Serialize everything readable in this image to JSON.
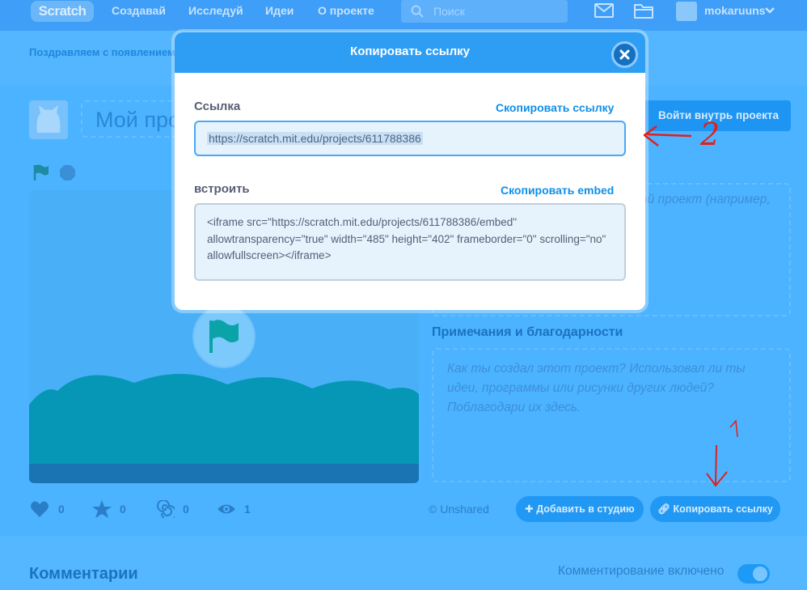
{
  "topbar": {
    "logo": "Scratch",
    "nav": [
      "Создавай",
      "Исследуй",
      "Идеи",
      "О проекте"
    ],
    "search_placeholder": "Поиск",
    "username": "mokaruuns"
  },
  "banner": {
    "text": "Поздравляем с появлением комментарии и делать ре"
  },
  "project": {
    "title": "Мой проект",
    "see_inside": "Войти внутрь проекта",
    "instructions_placeholder": "ой проект (например,",
    "notes_heading": "Примечания и благодарности",
    "notes_placeholder": "Как ты создал этот проект? Использовал ли ты идеи, программы или рисунки других людей? Поблагодари их здесь.",
    "stats": {
      "loves": "0",
      "favorites": "0",
      "remixes": "0",
      "views": "1"
    },
    "sharing_status": "© Unshared",
    "add_to_studio": "Добавить в студию",
    "copy_link": "Копировать ссылку"
  },
  "comments": {
    "heading": "Комментарии",
    "status": "Комментирование включено",
    "enabled": true
  },
  "annotations": {
    "number": "2"
  },
  "modal": {
    "title": "Копировать ссылку",
    "link_label": "Ссылка",
    "copy_link_action": "Скопировать ссылку",
    "link_value": "https://scratch.mit.edu/projects/611788386",
    "embed_label": "встроить",
    "copy_embed_action": "Скопировать embed",
    "embed_code": "<iframe src=\"https://scratch.mit.edu/projects/611788386/embed\" allowtransparency=\"true\" width=\"485\" height=\"402\" frameborder=\"0\" scrolling=\"no\" allowfullscreen></iframe>"
  },
  "colors": {
    "overlay_blue": "#4bb3ff",
    "modal_header": "#2e9ef5",
    "link_action": "#0e8fe9",
    "annotation_red": "#e0201b"
  }
}
